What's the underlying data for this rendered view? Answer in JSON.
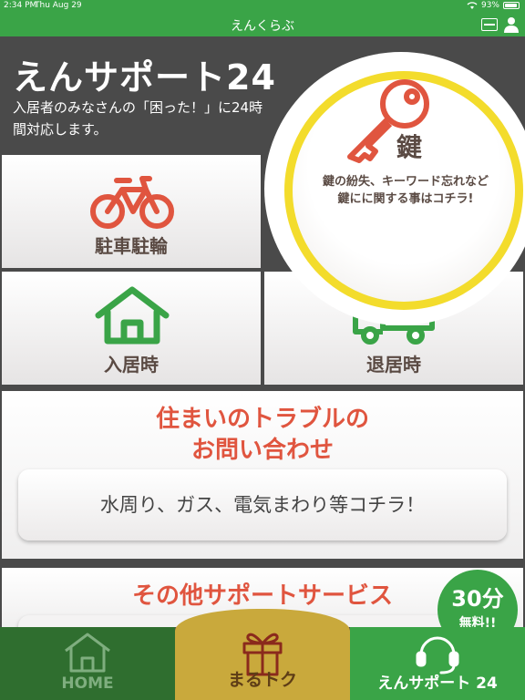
{
  "status_bar": {
    "time": "2:34 PM",
    "date": "Thu Aug 29",
    "battery": "93%",
    "battery_level": 0.93
  },
  "nav": {
    "title": "えんくらぶ"
  },
  "header": {
    "title": "えんサポート24",
    "description": "入居者のみなさんの「困った！」に24時間対応します。"
  },
  "tiles": {
    "key": {
      "label": "鍵",
      "description": "鍵の紛失、キーワード忘れなど鍵にに関する事はコチラ!"
    },
    "parking": {
      "label": "駐車駐輪"
    },
    "move_in": {
      "label": "入居時"
    },
    "move_out": {
      "label": "退居時"
    }
  },
  "trouble": {
    "title_line1": "住まいのトラブルの",
    "title_line2": "お問い合わせ",
    "button_label": "水周り、ガス、電気まわり等コチラ！"
  },
  "other": {
    "title": "その他サポートサービス",
    "badge_num": "30分",
    "badge_sub": "無料!!"
  },
  "tabs": {
    "home": "HOME",
    "maru": "まるトク",
    "en": "えんサポート 24"
  },
  "colors": {
    "green": "#3aa447",
    "dark_green": "#2f6e2f",
    "gold": "#c9a93c",
    "red": "#e0553f",
    "yellow_ring": "#f3dc2c",
    "dark_gray": "#4a4a4a"
  }
}
